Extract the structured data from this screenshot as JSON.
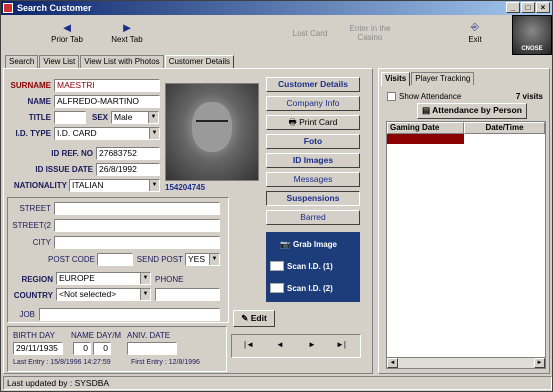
{
  "window": {
    "title": "Search Customer"
  },
  "toolbar": {
    "prior_tab": "Prior Tab",
    "next_tab": "Next Tab",
    "lost_card": "Lost Card",
    "enter_casino": "Enter in the Casino",
    "exit": "Exit"
  },
  "logo": {
    "text": "CNOSE"
  },
  "tabs": [
    "Search",
    "View List",
    "View List with Photos",
    "Customer Details"
  ],
  "form": {
    "surname_label": "SURNAME",
    "surname": "MAESTRI",
    "name_label": "NAME",
    "name": "ALFREDO-MARTINO",
    "title_label": "TITLE",
    "title": "",
    "sex_label": "SEX",
    "sex": "Male",
    "id_type_label": "I.D. TYPE",
    "id_type": "I.D. CARD",
    "id_ref_label": "ID REF. NO",
    "id_ref": "27683752",
    "id_issue_label": "ID ISSUE DATE",
    "id_issue": "26/8/1992",
    "nationality_label": "NATIONALITY",
    "nationality": "ITALIAN",
    "customer_number": "154204745",
    "street_label": "STREET",
    "street": "",
    "street2_label": "STREET(2",
    "street2": "",
    "city_label": "CITY",
    "city": "",
    "post_code_label": "POST CODE",
    "post_code": "",
    "send_post_label": "SEND POST",
    "send_post": "YES",
    "region_label": "REGION",
    "region": "EUROPE",
    "phone_label": "PHONE",
    "phone": "",
    "country_label": "COUNTRY",
    "country": "<Not selected>",
    "job_label": "JOB",
    "job": "",
    "birth_day_label": "BIRTH DAY",
    "birth_day": "29/11/1935",
    "name_day_label": "NAME DAY/M",
    "name_day_d": "0",
    "name_day_m": "0",
    "aniv_label": "ANIV. DATE",
    "aniv": "",
    "last_entry": "Last Entry : 15/8/1996 14:27:59",
    "first_entry": "First Entry : 12/8/1996"
  },
  "actions": {
    "customer_details": "Customer Details",
    "company_info": "Company Info",
    "print_card": "Print Card",
    "foto": "Foto",
    "id_images": "ID Images",
    "messages": "Messages",
    "suspensions": "Suspensions",
    "barred": "Barred",
    "grab_image": "Grab Image",
    "scan_id1": "Scan I.D. (1)",
    "scan_id2": "Scan I.D. (2)",
    "edit": "Edit"
  },
  "nav": {
    "first": "|◄",
    "prev": "◄",
    "next": "►",
    "last": "►|"
  },
  "right": {
    "tabs": [
      "Visits",
      "Player Tracking"
    ],
    "show_attendance": "Show Attendance",
    "visits_count": "7 visits",
    "attendance_by_person": "Attendance by Person",
    "columns": [
      "Gaming Date",
      "Date/Time"
    ]
  },
  "status": "Last updated by : SYSDBA"
}
